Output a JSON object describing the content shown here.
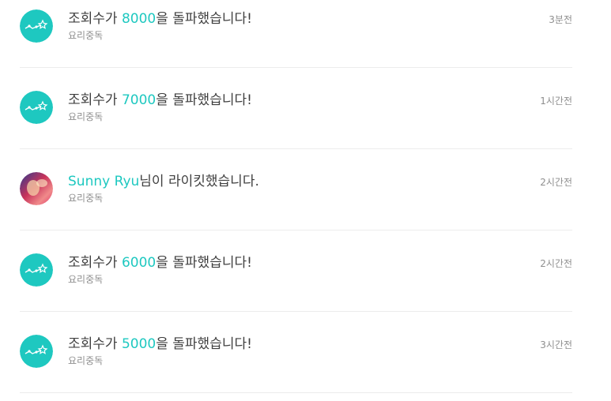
{
  "colors": {
    "accent": "#1ec8c0",
    "text": "#3f3f3f",
    "muted": "#8f8f8f",
    "divider": "#ececec"
  },
  "notifications": [
    {
      "icon": "chart-icon",
      "prefix": "조회수가 ",
      "highlight": "8000",
      "suffix": "을 돌파했습니다!",
      "source": "요리중독",
      "time": "3분전"
    },
    {
      "icon": "chart-icon",
      "prefix": "조회수가 ",
      "highlight": "7000",
      "suffix": "을 돌파했습니다!",
      "source": "요리중독",
      "time": "1시간전"
    },
    {
      "icon": "user-avatar",
      "prefix": "",
      "highlight": "Sunny Ryu",
      "suffix": "님이 라이킷했습니다.",
      "source": "요리중독",
      "time": "2시간전"
    },
    {
      "icon": "chart-icon",
      "prefix": "조회수가 ",
      "highlight": "6000",
      "suffix": "을 돌파했습니다!",
      "source": "요리중독",
      "time": "2시간전"
    },
    {
      "icon": "chart-icon",
      "prefix": "조회수가 ",
      "highlight": "5000",
      "suffix": "을 돌파했습니다!",
      "source": "요리중독",
      "time": "3시간전"
    }
  ]
}
